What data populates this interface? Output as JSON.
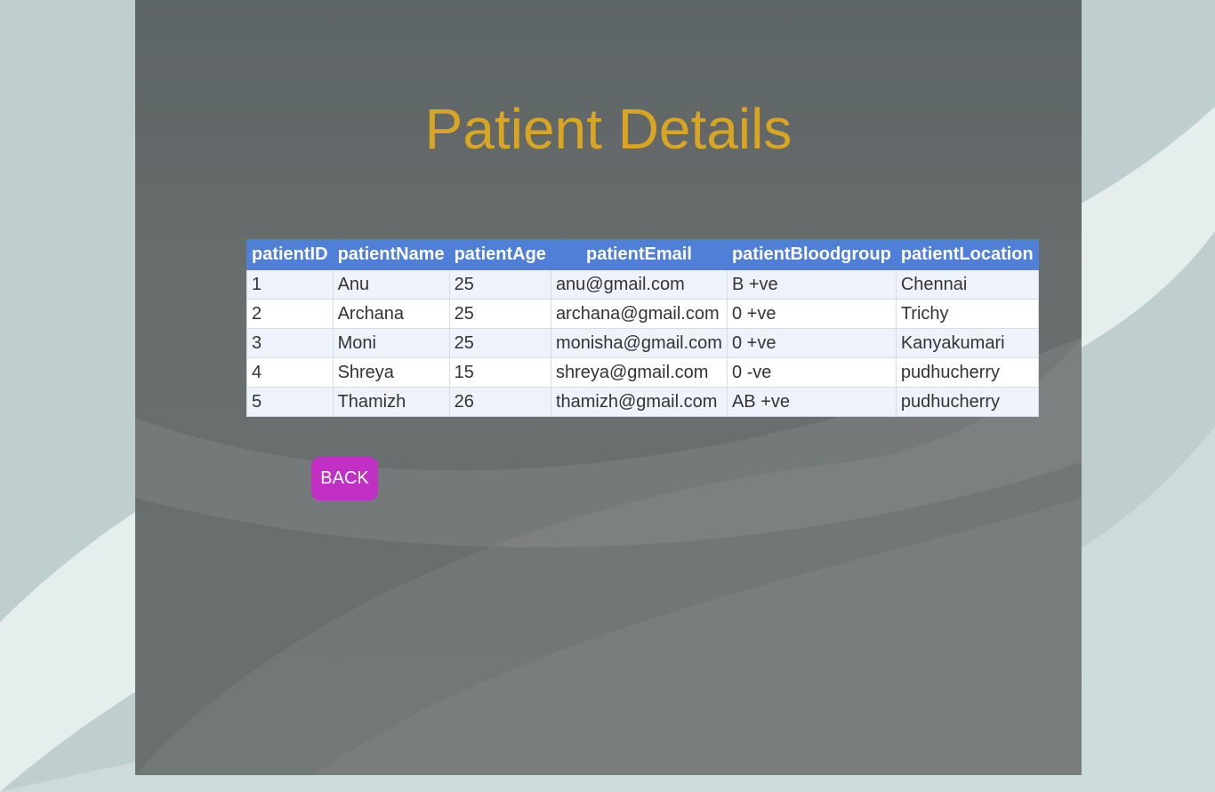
{
  "page": {
    "title": "Patient Details",
    "colors": {
      "title": "#daa520",
      "header_bg": "#4f7fd6",
      "back_button": "#c22fc4",
      "panel": "#666b6b"
    }
  },
  "table": {
    "headers": [
      "patientID",
      "patientName",
      "patientAge",
      "patientEmail",
      "patientBloodgroup",
      "patientLocation"
    ],
    "rows": [
      [
        "1",
        "Anu",
        "25",
        "anu@gmail.com",
        "B +ve",
        "Chennai"
      ],
      [
        "2",
        "Archana",
        "25",
        "archana@gmail.com",
        "0 +ve",
        "Trichy"
      ],
      [
        "3",
        "Moni",
        "25",
        "monisha@gmail.com",
        "0 +ve",
        "Kanyakumari"
      ],
      [
        "4",
        "Shreya",
        "15",
        "shreya@gmail.com",
        "0 -ve",
        "pudhucherry"
      ],
      [
        "5",
        "Thamizh",
        "26",
        "thamizh@gmail.com",
        "AB +ve",
        "pudhucherry"
      ]
    ]
  },
  "actions": {
    "back_label": "BACK"
  }
}
